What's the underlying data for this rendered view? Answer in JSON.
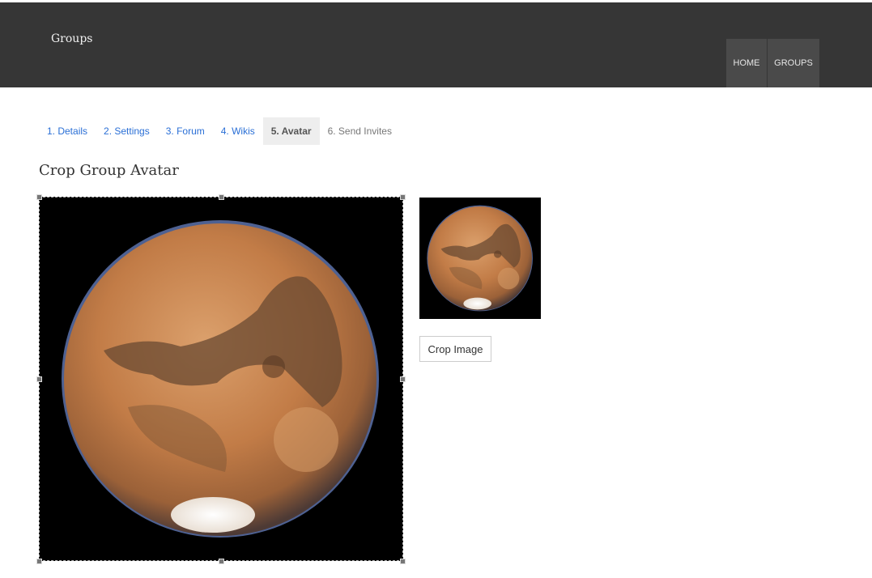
{
  "header": {
    "site_title": "Groups",
    "nav": [
      {
        "label": "HOME"
      },
      {
        "label": "GROUPS"
      }
    ]
  },
  "steps": [
    {
      "label": "1. Details",
      "state": "link"
    },
    {
      "label": "2. Settings",
      "state": "link"
    },
    {
      "label": "3. Forum",
      "state": "link"
    },
    {
      "label": "4. Wikis",
      "state": "link"
    },
    {
      "label": "5. Avatar",
      "state": "active"
    },
    {
      "label": "6. Send Invites",
      "state": "disabled"
    }
  ],
  "main": {
    "title": "Crop Group Avatar",
    "crop_button_label": "Crop Image"
  },
  "colors": {
    "header_bg": "#363636",
    "nav_bg": "#4a4a4a",
    "link": "#2a6fd6",
    "planet_base": "#c8804d",
    "planet_dark": "#5a3b25",
    "polar_cap": "#f4f4f4"
  }
}
